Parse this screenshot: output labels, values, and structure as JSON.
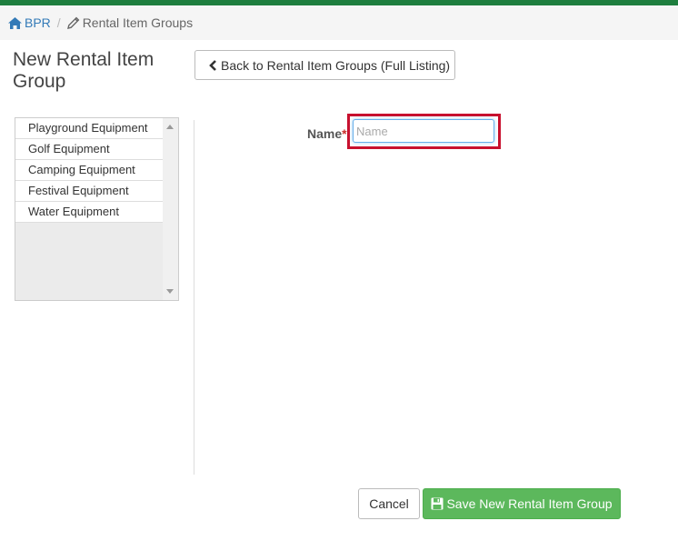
{
  "breadcrumb": {
    "home_label": "BPR",
    "current_label": "Rental Item Groups"
  },
  "page": {
    "title": "New Rental Item Group"
  },
  "back_button": {
    "label": "Back to Rental Item Groups (Full Listing)"
  },
  "group_list": {
    "items": [
      {
        "label": "Playground Equipment"
      },
      {
        "label": "Golf Equipment"
      },
      {
        "label": "Camping Equipment"
      },
      {
        "label": "Festival Equipment"
      },
      {
        "label": "Water Equipment"
      }
    ]
  },
  "form": {
    "name_label": "Name",
    "required_marker": "*",
    "name_value": "",
    "name_placeholder": "Name"
  },
  "actions": {
    "cancel_label": "Cancel",
    "save_label": "Save New Rental Item Group"
  },
  "colors": {
    "topbar": "#1e7e3e",
    "link": "#337ab7",
    "highlight": "#c8102e",
    "save_button": "#5cb85c"
  },
  "icons": {
    "home": "home-icon",
    "breadcrumb_edit": "pencil-icon",
    "back": "chevron-left-icon",
    "save": "floppy-disk-icon"
  }
}
